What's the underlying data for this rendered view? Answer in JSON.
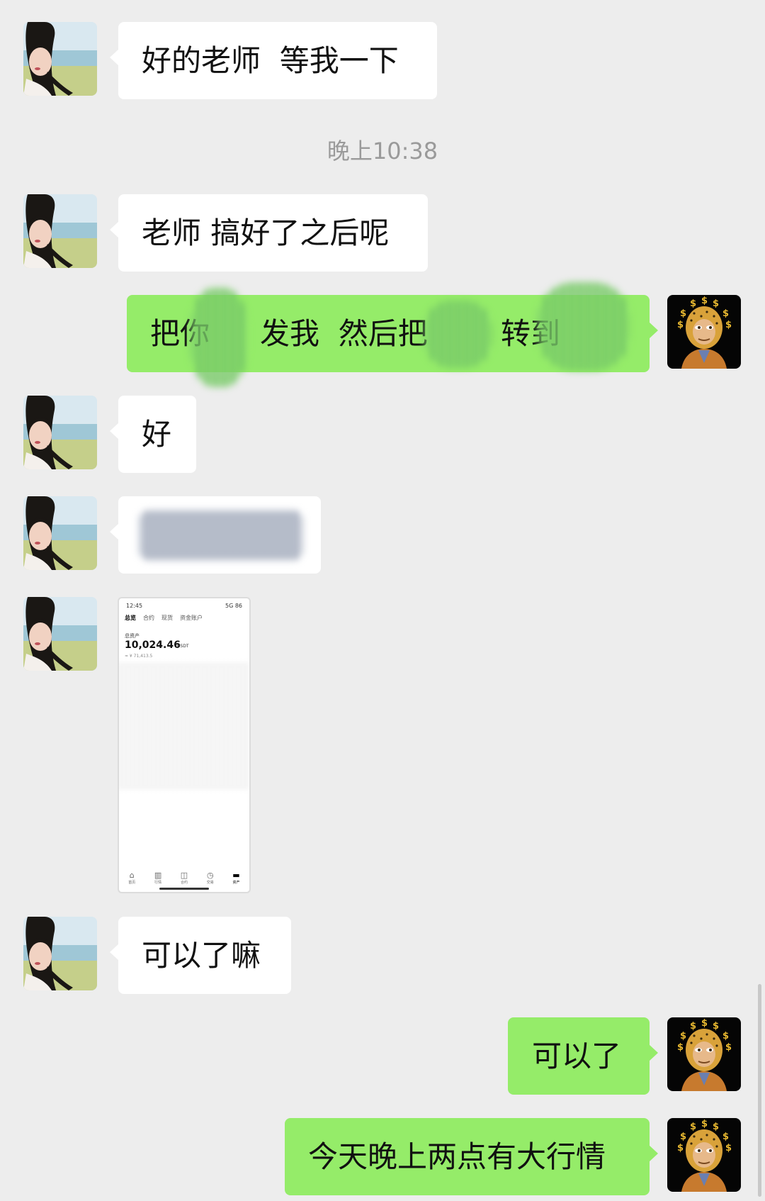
{
  "messages": {
    "m1": "好的老师  等我一下",
    "ts": "晚上10:38",
    "m2": "老师 搞好了之后呢",
    "m3_a": "把你",
    "m3_b": "发我  然后把",
    "m3_c": "转到",
    "m4": "好",
    "m7": "可以了嘛",
    "m8": "可以了",
    "m9": "今天晚上两点有大行情"
  },
  "screenshot": {
    "time": "12:45",
    "battery": "5G 86",
    "tabs": [
      "总览",
      "合约",
      "现货",
      "资金账户"
    ],
    "assets_label": "总资产",
    "balance": "10,024.46",
    "unit": "USDT",
    "approx": "≈ ¥ 71,413.5",
    "nav": [
      "首页",
      "行情",
      "合约",
      "交易",
      "资产"
    ]
  },
  "colors": {
    "background": "#ededed",
    "incoming_bubble": "#ffffff",
    "outgoing_bubble": "#95ec69"
  },
  "icons": {
    "left_avatar": "woman-photo-avatar",
    "right_avatar": "gold-ape-avatar"
  }
}
